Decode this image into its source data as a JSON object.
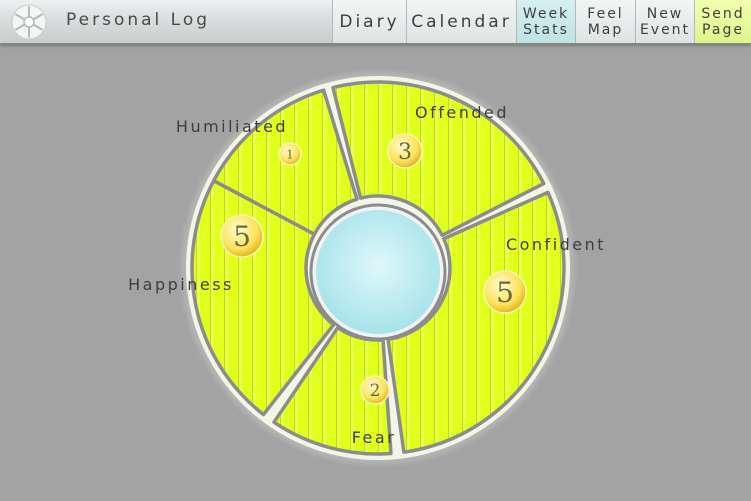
{
  "header": {
    "title": "Personal Log",
    "nav": [
      {
        "lines": [
          "Diary"
        ]
      },
      {
        "lines": [
          "Calendar"
        ]
      },
      {
        "lines": [
          "Week",
          "Stats"
        ]
      },
      {
        "lines": [
          "Feel",
          "Map"
        ]
      },
      {
        "lines": [
          "New",
          "Event"
        ]
      },
      {
        "lines": [
          "Send",
          "Page"
        ]
      }
    ]
  },
  "feelings": [
    {
      "name": "Offended",
      "count": "3"
    },
    {
      "name": "Confident",
      "count": "5"
    },
    {
      "name": "Fear",
      "count": "2"
    },
    {
      "name": "Happiness",
      "count": "5"
    },
    {
      "name": "Humiliated",
      "count": "1"
    }
  ],
  "colors": {
    "segment": "#e0ff1c",
    "hub": "#bfeef2",
    "background": "#a3a3a3"
  }
}
